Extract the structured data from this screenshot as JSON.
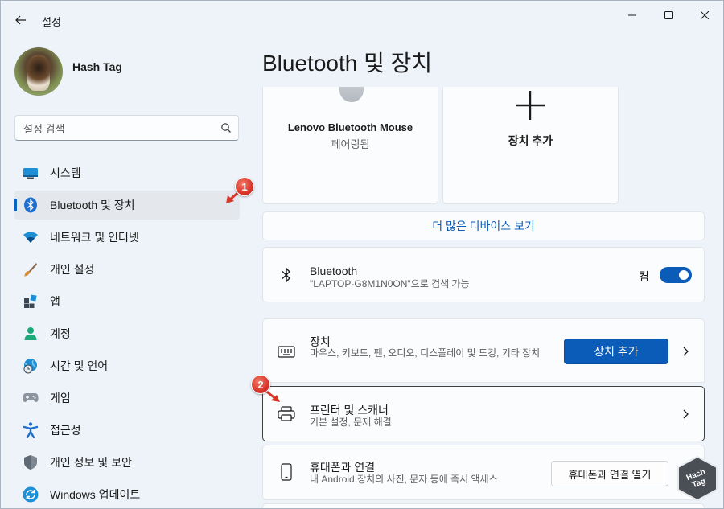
{
  "window": {
    "title": "설정"
  },
  "user": {
    "name": "Hash Tag"
  },
  "search": {
    "placeholder": "설정 검색"
  },
  "sidebar": {
    "items": [
      {
        "label": "시스템",
        "icon": "system-icon"
      },
      {
        "label": "Bluetooth 및 장치",
        "icon": "bluetooth-icon",
        "active": true
      },
      {
        "label": "네트워크 및 인터넷",
        "icon": "wifi-icon"
      },
      {
        "label": "개인 설정",
        "icon": "brush-icon"
      },
      {
        "label": "앱",
        "icon": "apps-icon"
      },
      {
        "label": "계정",
        "icon": "account-icon"
      },
      {
        "label": "시간 및 언어",
        "icon": "globe-clock-icon"
      },
      {
        "label": "게임",
        "icon": "gamepad-icon"
      },
      {
        "label": "접근성",
        "icon": "accessibility-icon"
      },
      {
        "label": "개인 정보 및 보안",
        "icon": "shield-icon"
      },
      {
        "label": "Windows 업데이트",
        "icon": "update-icon"
      }
    ]
  },
  "annotations": {
    "badge1": "1",
    "badge2": "2"
  },
  "main": {
    "title": "Bluetooth 및 장치",
    "device_card": {
      "name": "Lenovo Bluetooth Mouse",
      "status": "페어링됨"
    },
    "add_card": {
      "label": "장치 추가"
    },
    "more_devices": "더 많은 디바이스 보기",
    "bluetooth": {
      "title": "Bluetooth",
      "subtitle": "\"LAPTOP-G8M1N0ON\"으로 검색 가능",
      "toggle_label": "켬",
      "toggle_on": true
    },
    "devices": {
      "title": "장치",
      "subtitle": "마우스, 키보드, 펜, 오디오, 디스플레이 및 도킹, 기타 장치",
      "button": "장치 추가"
    },
    "printers": {
      "title": "프린터 및 스캐너",
      "subtitle": "기본 설정, 문제 해결"
    },
    "phone": {
      "title": "휴대폰과 연결",
      "subtitle": "내 Android 장치의 사진, 문자 등에 즉시 액세스",
      "button": "휴대폰과 연결 열기"
    }
  },
  "colors": {
    "accent": "#0a5cb8",
    "badge": "#d9362a",
    "background": "#eef3f9"
  }
}
